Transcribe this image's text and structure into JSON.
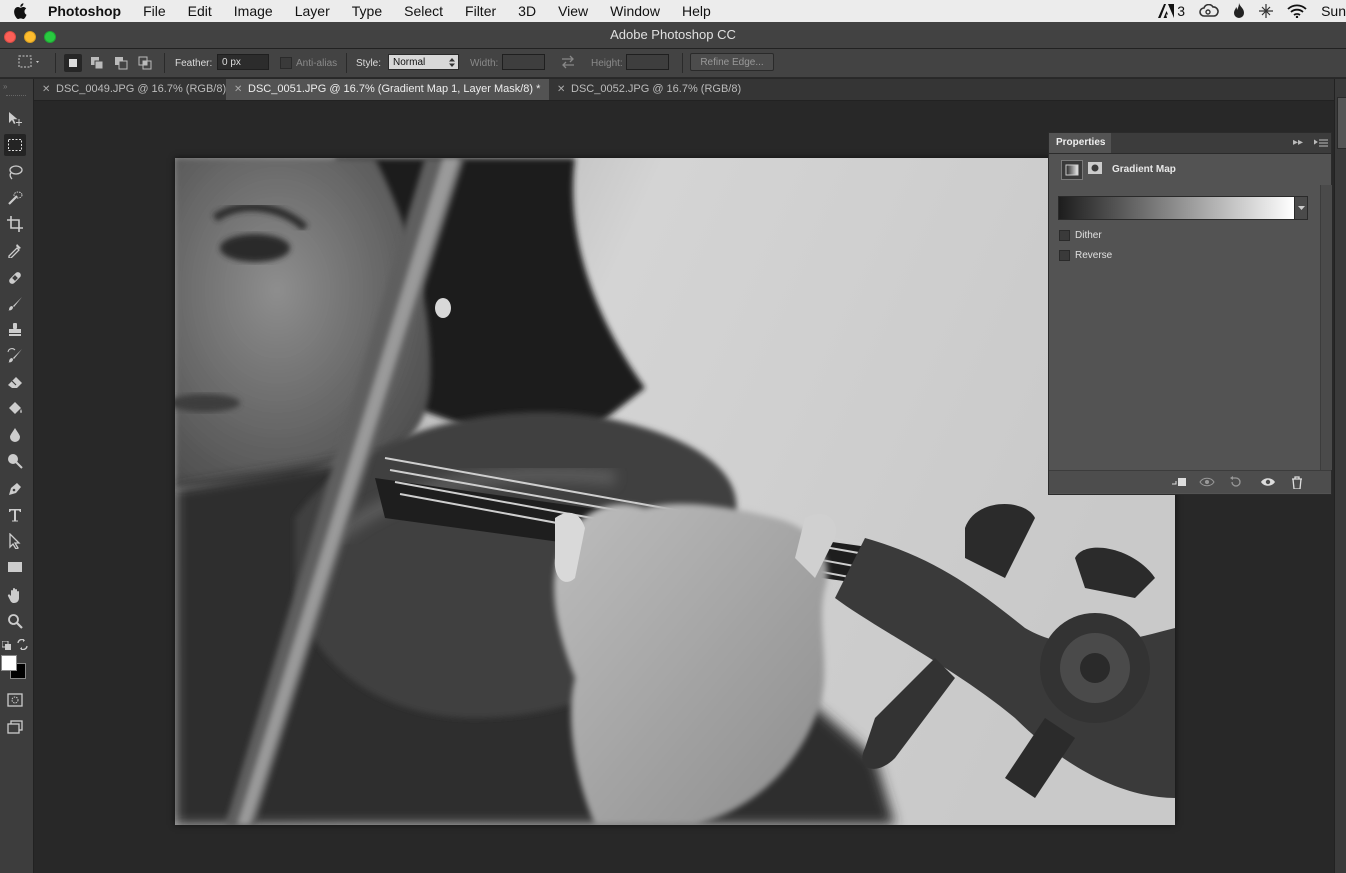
{
  "menubar": {
    "app_name": "Photoshop",
    "items": [
      "File",
      "Edit",
      "Image",
      "Layer",
      "Type",
      "Select",
      "Filter",
      "3D",
      "View",
      "Window",
      "Help"
    ],
    "status": {
      "adobe_count": "3",
      "clock": "Sun"
    }
  },
  "window": {
    "title": "Adobe Photoshop CC"
  },
  "options": {
    "feather_label": "Feather:",
    "feather_value": "0 px",
    "antialias_label": "Anti-alias",
    "style_label": "Style:",
    "style_value": "Normal",
    "width_label": "Width:",
    "height_label": "Height:",
    "refine_edge_label": "Refine Edge..."
  },
  "tabs": [
    {
      "label": "DSC_0049.JPG @ 16.7% (RGB/8)",
      "active": false
    },
    {
      "label": "DSC_0051.JPG @ 16.7% (Gradient Map 1, Layer Mask/8) *",
      "active": true
    },
    {
      "label": "DSC_0052.JPG @ 16.7% (RGB/8)",
      "active": false
    }
  ],
  "tools": [
    "move-tool",
    "rectangular-marquee-tool",
    "lasso-tool",
    "quick-selection-tool",
    "crop-tool",
    "eyedropper-tool",
    "healing-brush-tool",
    "brush-tool",
    "clone-stamp-tool",
    "history-brush-tool",
    "eraser-tool",
    "paint-bucket-tool",
    "blur-tool",
    "dodge-tool",
    "pen-tool",
    "type-tool",
    "path-selection-tool",
    "rectangle-tool",
    "hand-tool",
    "zoom-tool"
  ],
  "colors": {
    "foreground": "#ffffff",
    "background": "#000000"
  },
  "properties": {
    "panel_title": "Properties",
    "adjustment_name": "Gradient Map",
    "gradient": {
      "start": "#1d1d1d",
      "end": "#ffffff"
    },
    "dither_label": "Dither",
    "dither_checked": false,
    "reverse_label": "Reverse",
    "reverse_checked": false
  }
}
